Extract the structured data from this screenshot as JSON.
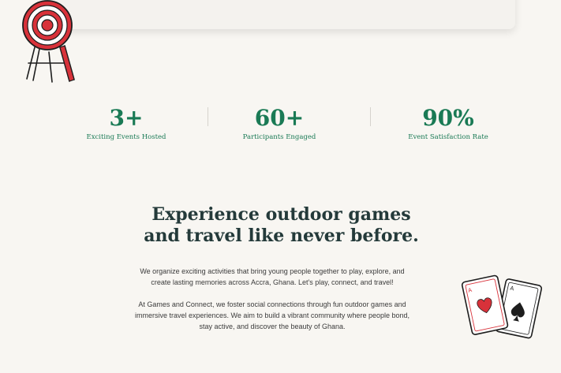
{
  "stats": [
    {
      "value": "3+",
      "label": "Exciting Events Hosted"
    },
    {
      "value": "60+",
      "label": "Participants Engaged"
    },
    {
      "value": "90%",
      "label": "Event Satisfaction Rate"
    }
  ],
  "about": {
    "headline_line1": "Experience outdoor games",
    "headline_line2": "and travel like never before.",
    "para1_line1": "We organize exciting activities that bring young people together to play, explore, and",
    "para1_line2": "create lasting memories across Accra, Ghana. Let's play, connect, and travel!",
    "para2_line1": "At Games and Connect, we foster social connections through fun outdoor games and",
    "para2_line2": "immersive travel experiences. We aim to build a vibrant community where people bond,",
    "para2_line3": "stay active, and discover the beauty of Ghana."
  },
  "colors": {
    "accent_green": "#1a7a55",
    "background": "#f8f6f2",
    "target_red": "#d8323a"
  },
  "icons": [
    "archery-target-icon",
    "playing-cards-icon"
  ]
}
